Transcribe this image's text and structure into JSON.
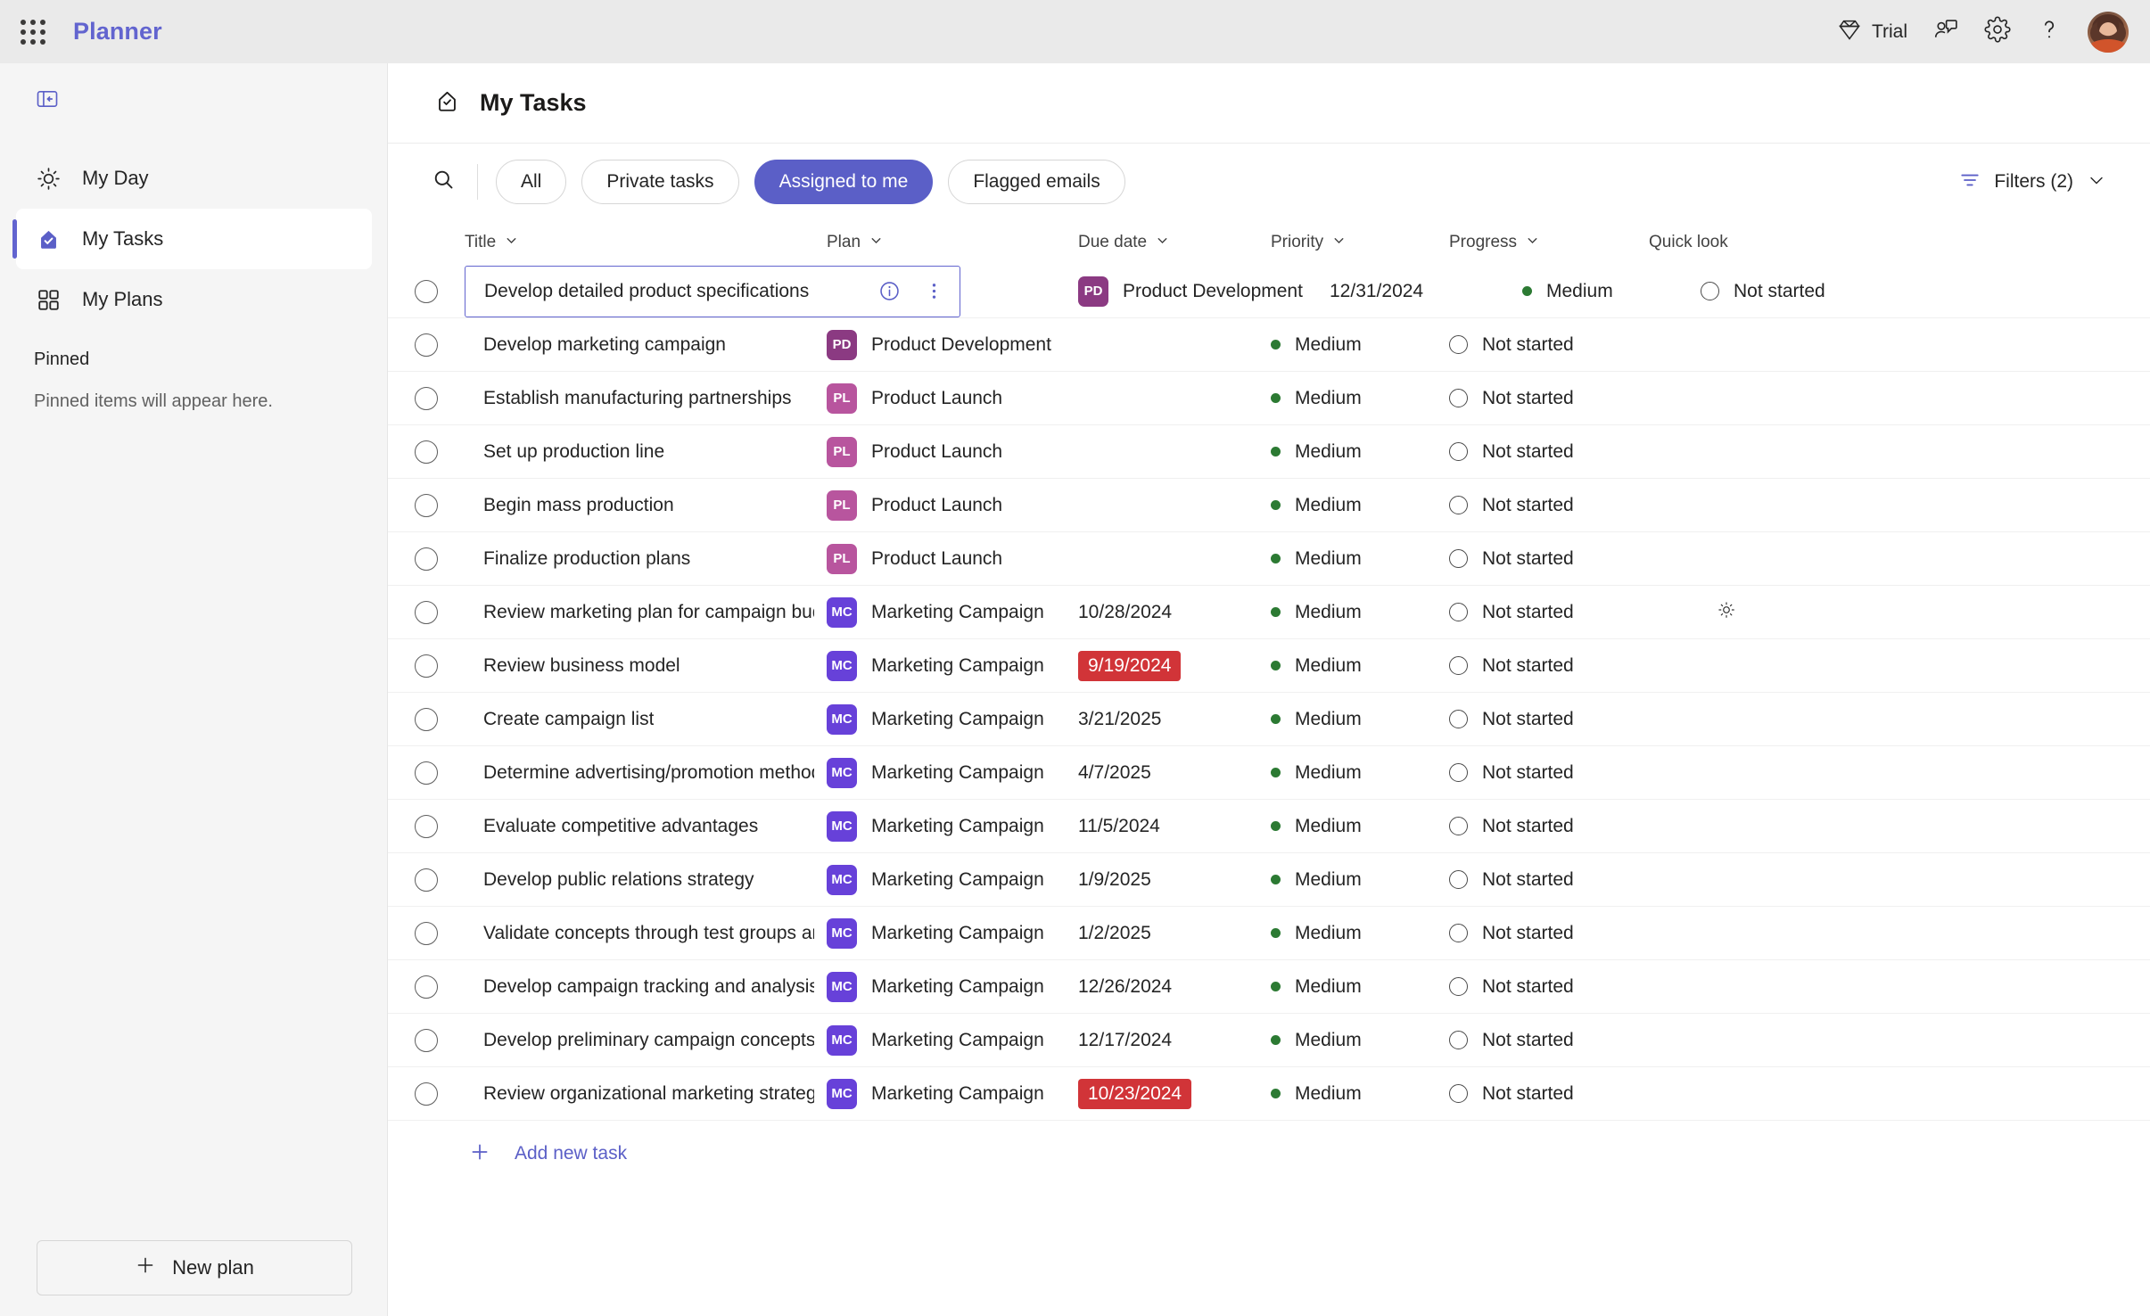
{
  "appbar": {
    "waffle_icon": "app-launcher-icon",
    "title": "Planner",
    "trial_label": "Trial",
    "trial_icon": "diamond-icon",
    "feedback_icon": "feedback-icon",
    "settings_icon": "gear-icon",
    "help_icon": "help-icon",
    "avatar_name": "user-avatar"
  },
  "sidebar": {
    "collapse_icon": "collapse-sidebar-icon",
    "items": [
      {
        "label": "My Day",
        "icon": "sun-icon",
        "active": false
      },
      {
        "label": "My Tasks",
        "icon": "tasks-icon",
        "active": true
      },
      {
        "label": "My Plans",
        "icon": "grid-icon",
        "active": false
      }
    ],
    "pinned_header": "Pinned",
    "pinned_empty": "Pinned items will appear here.",
    "new_plan_label": "New plan",
    "new_plan_icon": "plus-icon"
  },
  "page": {
    "title": "My Tasks",
    "title_icon": "tasks-icon"
  },
  "toolbar": {
    "search_icon": "search-icon",
    "tabs": [
      {
        "label": "All",
        "active": false
      },
      {
        "label": "Private tasks",
        "active": false
      },
      {
        "label": "Assigned to me",
        "active": true
      },
      {
        "label": "Flagged emails",
        "active": false
      }
    ],
    "filters_label": "Filters (2)",
    "filters_icon": "filter-icon",
    "filters_chevron": "chevron-down-icon"
  },
  "table": {
    "columns": [
      {
        "key": "title",
        "label": "Title"
      },
      {
        "key": "plan",
        "label": "Plan"
      },
      {
        "key": "due",
        "label": "Due date"
      },
      {
        "key": "priority",
        "label": "Priority"
      },
      {
        "key": "progress",
        "label": "Progress"
      },
      {
        "key": "quick",
        "label": "Quick look"
      }
    ],
    "add_task_label": "Add new task",
    "rows": [
      {
        "title": "Develop detailed product specifications",
        "plan_initials": "PD",
        "plan_color": "#8b3a82",
        "plan": "Product Development",
        "due": "12/31/2024",
        "overdue": false,
        "priority": "Medium",
        "priority_color": "#2c7a33",
        "progress": "Not started",
        "quick_icon": "",
        "focused": true
      },
      {
        "title": "Develop marketing campaign",
        "plan_initials": "PD",
        "plan_color": "#8b3a82",
        "plan": "Product Development",
        "due": "",
        "overdue": false,
        "priority": "Medium",
        "priority_color": "#2c7a33",
        "progress": "Not started",
        "quick_icon": "",
        "focused": false
      },
      {
        "title": "Establish manufacturing partnerships",
        "plan_initials": "PL",
        "plan_color": "#b8559e",
        "plan": "Product Launch",
        "due": "",
        "overdue": false,
        "priority": "Medium",
        "priority_color": "#2c7a33",
        "progress": "Not started",
        "quick_icon": "",
        "focused": false
      },
      {
        "title": "Set up production line",
        "plan_initials": "PL",
        "plan_color": "#b8559e",
        "plan": "Product Launch",
        "due": "",
        "overdue": false,
        "priority": "Medium",
        "priority_color": "#2c7a33",
        "progress": "Not started",
        "quick_icon": "",
        "focused": false
      },
      {
        "title": "Begin mass production",
        "plan_initials": "PL",
        "plan_color": "#b8559e",
        "plan": "Product Launch",
        "due": "",
        "overdue": false,
        "priority": "Medium",
        "priority_color": "#2c7a33",
        "progress": "Not started",
        "quick_icon": "",
        "focused": false
      },
      {
        "title": "Finalize production plans",
        "plan_initials": "PL",
        "plan_color": "#b8559e",
        "plan": "Product Launch",
        "due": "",
        "overdue": false,
        "priority": "Medium",
        "priority_color": "#2c7a33",
        "progress": "Not started",
        "quick_icon": "",
        "focused": false
      },
      {
        "title": "Review marketing plan for campaign budget",
        "plan_initials": "MC",
        "plan_color": "#6741d9",
        "plan": "Marketing Campaign",
        "due": "10/28/2024",
        "overdue": false,
        "priority": "Medium",
        "priority_color": "#2c7a33",
        "progress": "Not started",
        "quick_icon": "sun-icon",
        "focused": false
      },
      {
        "title": "Review business model",
        "plan_initials": "MC",
        "plan_color": "#6741d9",
        "plan": "Marketing Campaign",
        "due": "9/19/2024",
        "overdue": true,
        "priority": "Medium",
        "priority_color": "#2c7a33",
        "progress": "Not started",
        "quick_icon": "",
        "focused": false
      },
      {
        "title": "Create campaign list",
        "plan_initials": "MC",
        "plan_color": "#6741d9",
        "plan": "Marketing Campaign",
        "due": "3/21/2025",
        "overdue": false,
        "priority": "Medium",
        "priority_color": "#2c7a33",
        "progress": "Not started",
        "quick_icon": "",
        "focused": false
      },
      {
        "title": "Determine advertising/promotion methods and mix",
        "plan_initials": "MC",
        "plan_color": "#6741d9",
        "plan": "Marketing Campaign",
        "due": "4/7/2025",
        "overdue": false,
        "priority": "Medium",
        "priority_color": "#2c7a33",
        "progress": "Not started",
        "quick_icon": "",
        "focused": false
      },
      {
        "title": "Evaluate competitive advantages",
        "plan_initials": "MC",
        "plan_color": "#6741d9",
        "plan": "Marketing Campaign",
        "due": "11/5/2024",
        "overdue": false,
        "priority": "Medium",
        "priority_color": "#2c7a33",
        "progress": "Not started",
        "quick_icon": "",
        "focused": false
      },
      {
        "title": "Develop public relations strategy",
        "plan_initials": "MC",
        "plan_color": "#6741d9",
        "plan": "Marketing Campaign",
        "due": "1/9/2025",
        "overdue": false,
        "priority": "Medium",
        "priority_color": "#2c7a33",
        "progress": "Not started",
        "quick_icon": "",
        "focused": false
      },
      {
        "title": "Validate concepts through test groups and market resea",
        "plan_initials": "MC",
        "plan_color": "#6741d9",
        "plan": "Marketing Campaign",
        "due": "1/2/2025",
        "overdue": false,
        "priority": "Medium",
        "priority_color": "#2c7a33",
        "progress": "Not started",
        "quick_icon": "",
        "focused": false
      },
      {
        "title": "Develop campaign tracking and analysis process",
        "plan_initials": "MC",
        "plan_color": "#6741d9",
        "plan": "Marketing Campaign",
        "due": "12/26/2024",
        "overdue": false,
        "priority": "Medium",
        "priority_color": "#2c7a33",
        "progress": "Not started",
        "quick_icon": "",
        "focused": false
      },
      {
        "title": "Develop preliminary campaign concepts",
        "plan_initials": "MC",
        "plan_color": "#6741d9",
        "plan": "Marketing Campaign",
        "due": "12/17/2024",
        "overdue": false,
        "priority": "Medium",
        "priority_color": "#2c7a33",
        "progress": "Not started",
        "quick_icon": "",
        "focused": false
      },
      {
        "title": "Review organizational marketing strategy",
        "plan_initials": "MC",
        "plan_color": "#6741d9",
        "plan": "Marketing Campaign",
        "due": "10/23/2024",
        "overdue": true,
        "priority": "Medium",
        "priority_color": "#2c7a33",
        "progress": "Not started",
        "quick_icon": "",
        "focused": false
      }
    ],
    "row1_info_icon": "info-icon",
    "row1_more_icon": "more-options-icon"
  },
  "colors": {
    "accent": "#5b5fc7",
    "brand": "#6264cf",
    "overdue": "#d13438",
    "priority_medium": "#2c7a33"
  }
}
